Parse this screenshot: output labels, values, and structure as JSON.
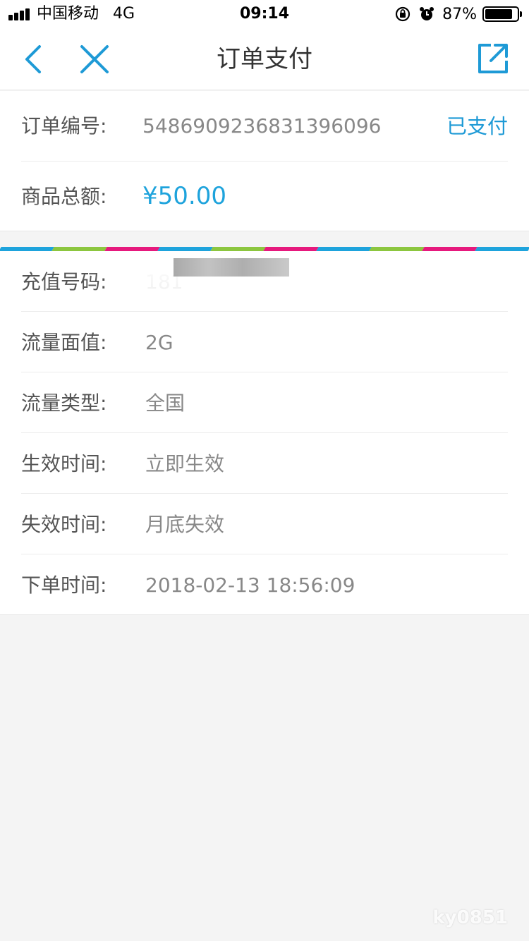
{
  "status_bar": {
    "carrier": "中国移动",
    "network": "4G",
    "time": "09:14",
    "battery_percent": "87%",
    "battery_level": 0.87,
    "icons": [
      "rotation-lock-icon",
      "alarm-icon"
    ]
  },
  "nav": {
    "title": "订单支付",
    "back_icon": "chevron-left-icon",
    "close_icon": "close-icon",
    "share_icon": "share-external-icon",
    "accent": "#1e9ad6"
  },
  "order": {
    "number_label": "订单编号:",
    "number_value": "5486909236831396096",
    "status": "已支付",
    "amount_label": "商品总额:",
    "amount_value": "¥50.00"
  },
  "details": [
    {
      "label": "充值号码:",
      "value": "181"
    },
    {
      "label": "流量面值:",
      "value": "2G"
    },
    {
      "label": "流量类型:",
      "value": "全国"
    },
    {
      "label": "生效时间:",
      "value": "立即生效"
    },
    {
      "label": "失效时间:",
      "value": "月底失效"
    },
    {
      "label": "下单时间:",
      "value": "2018-02-13 18:56:09"
    }
  ],
  "stripe_colors": [
    "#1ea3dc",
    "#8cc63f",
    "#e6197d"
  ],
  "watermark": "ky0851"
}
